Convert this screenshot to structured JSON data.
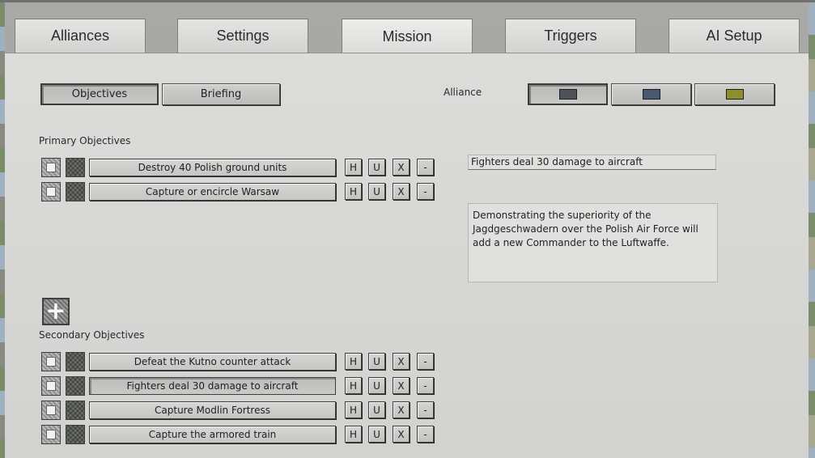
{
  "tabs": [
    "Alliances",
    "Settings",
    "Mission",
    "Triggers",
    "AI Setup"
  ],
  "active_tab": "Mission",
  "subtabs": {
    "objectives": "Objectives",
    "briefing": "Briefing"
  },
  "alliance": {
    "label": "Alliance",
    "swatches": [
      "#4d5358",
      "#485a6f",
      "#8e8f2c"
    ]
  },
  "primary": {
    "heading": "Primary Objectives",
    "items": [
      "Destroy 40 Polish ground units",
      "Capture or encircle Warsaw"
    ]
  },
  "secondary": {
    "heading": "Secondary Objectives",
    "items": [
      "Defeat the Kutno counter attack",
      "Fighters deal 30 damage to aircraft",
      "Capture Modlin Fortress",
      "Capture the armored train"
    ]
  },
  "row_buttons": {
    "h": "H",
    "u": "U",
    "x": "X",
    "minus": "-"
  },
  "add_button": "+",
  "detail": {
    "title": "Fighters deal 30 damage to aircraft",
    "description": "Demonstrating the superiority of the Jagdgeschwadern over the Polish Air Force will add a new Commander to the Luftwaffe."
  }
}
